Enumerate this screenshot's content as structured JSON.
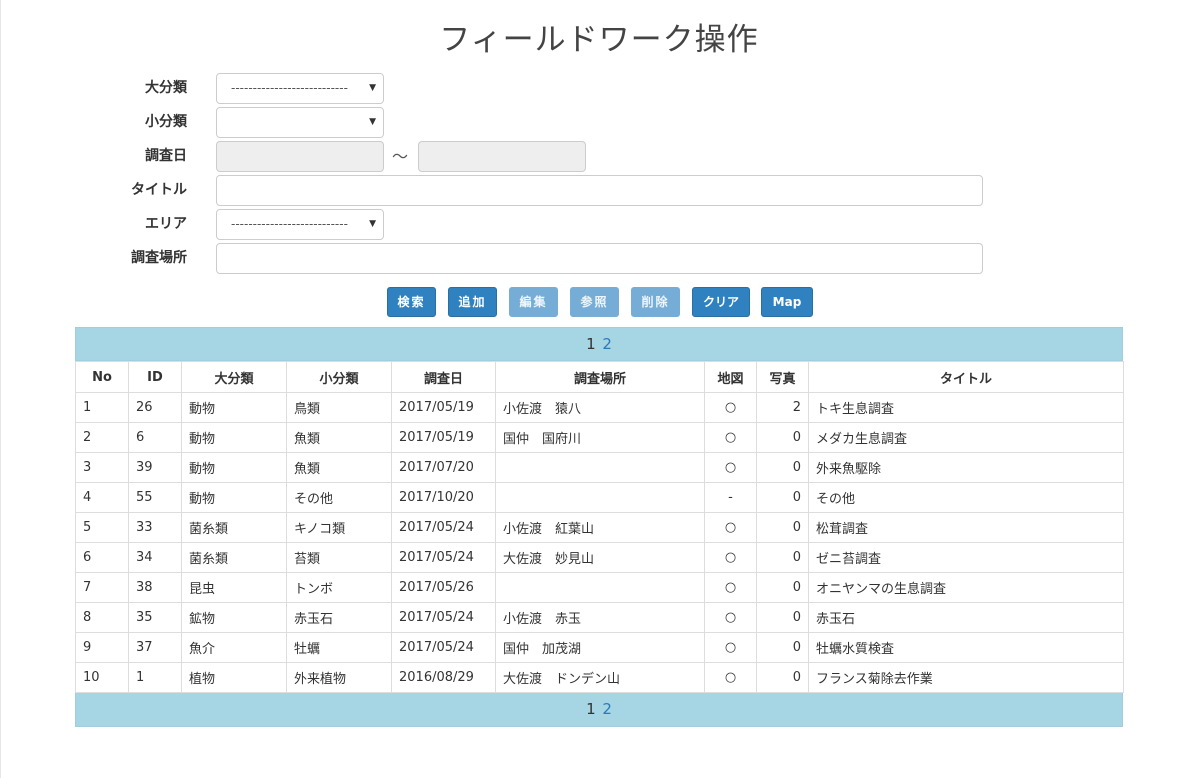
{
  "title": "フィールドワーク操作",
  "form": {
    "major_label": "大分類",
    "major_value": "---------------------------",
    "minor_label": "小分類",
    "minor_value": "",
    "date_label": "調査日",
    "date_from": "",
    "date_to": "",
    "date_separator": "～",
    "title_label": "タイトル",
    "title_value": "",
    "area_label": "エリア",
    "area_value": "---------------------------",
    "place_label": "調査場所",
    "place_value": ""
  },
  "buttons": {
    "search": "検索",
    "add": "追加",
    "edit": "編集",
    "reference": "参照",
    "delete": "削除",
    "clear": "クリア",
    "map": "Map"
  },
  "pagination": {
    "current": "1",
    "next": "2"
  },
  "table": {
    "headers": [
      "No",
      "ID",
      "大分類",
      "小分類",
      "調査日",
      "調査場所",
      "地図",
      "写真",
      "タイトル"
    ],
    "rows": [
      [
        "1",
        "26",
        "動物",
        "鳥類",
        "2017/05/19",
        "小佐渡　猿八",
        "○",
        "2",
        "トキ生息調査"
      ],
      [
        "2",
        "6",
        "動物",
        "魚類",
        "2017/05/19",
        "国仲　国府川",
        "○",
        "0",
        "メダカ生息調査"
      ],
      [
        "3",
        "39",
        "動物",
        "魚類",
        "2017/07/20",
        "",
        "○",
        "0",
        "外来魚駆除"
      ],
      [
        "4",
        "55",
        "動物",
        "その他",
        "2017/10/20",
        "",
        "-",
        "0",
        "その他"
      ],
      [
        "5",
        "33",
        "菌糸類",
        "キノコ類",
        "2017/05/24",
        "小佐渡　紅葉山",
        "○",
        "0",
        "松茸調査"
      ],
      [
        "6",
        "34",
        "菌糸類",
        "苔類",
        "2017/05/24",
        "大佐渡　妙見山",
        "○",
        "0",
        "ゼニ苔調査"
      ],
      [
        "7",
        "38",
        "昆虫",
        "トンボ",
        "2017/05/26",
        "",
        "○",
        "0",
        "オニヤンマの生息調査"
      ],
      [
        "8",
        "35",
        "鉱物",
        "赤玉石",
        "2017/05/24",
        "小佐渡　赤玉",
        "○",
        "0",
        "赤玉石"
      ],
      [
        "9",
        "37",
        "魚介",
        "牡蠣",
        "2017/05/24",
        "国仲　加茂湖",
        "○",
        "0",
        "牡蠣水質検査"
      ],
      [
        "10",
        "1",
        "植物",
        "外来植物",
        "2016/08/29",
        "大佐渡　ドンデン山",
        "○",
        "0",
        "フランス菊除去作業"
      ]
    ]
  },
  "icons": {
    "select_caret": "caret-down-icon"
  },
  "colors": {
    "primary": "#2f82bf",
    "disabled": "#76add6",
    "pager_bg": "#a6d5e3",
    "link": "#2a7ab8"
  }
}
